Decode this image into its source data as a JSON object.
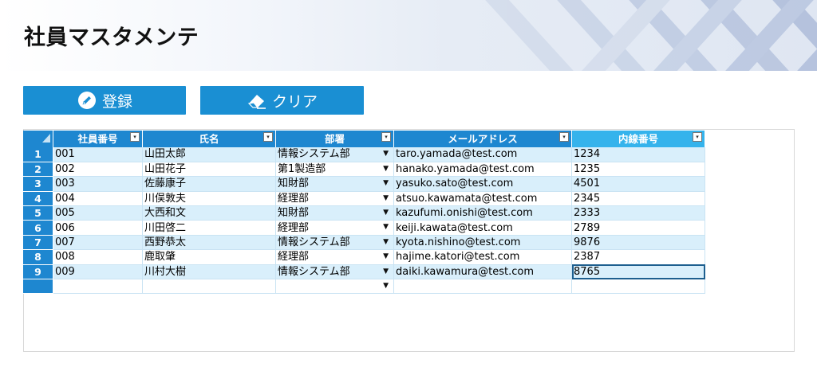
{
  "app": {
    "title": "社員マスタメンテ"
  },
  "toolbar": {
    "register_label": "登録",
    "clear_label": "クリア"
  },
  "table": {
    "columns": [
      "社員番号",
      "氏名",
      "部署",
      "メールアドレス",
      "内線番号"
    ],
    "rows": [
      {
        "no": "1",
        "id": "001",
        "name": "山田太郎",
        "dept": "情報システム部",
        "email": "taro.yamada@test.com",
        "ext": "1234"
      },
      {
        "no": "2",
        "id": "002",
        "name": "山田花子",
        "dept": "第1製造部",
        "email": "hanako.yamada@test.com",
        "ext": "1235"
      },
      {
        "no": "3",
        "id": "003",
        "name": "佐藤康子",
        "dept": "知財部",
        "email": "yasuko.sato@test.com",
        "ext": "4501"
      },
      {
        "no": "4",
        "id": "004",
        "name": "川俣敦夫",
        "dept": "経理部",
        "email": "atsuo.kawamata@test.com",
        "ext": "2345"
      },
      {
        "no": "5",
        "id": "005",
        "name": "大西和文",
        "dept": "知財部",
        "email": "kazufumi.onishi@test.com",
        "ext": "2333"
      },
      {
        "no": "6",
        "id": "006",
        "name": "川田啓二",
        "dept": "経理部",
        "email": "keiji.kawata@test.com",
        "ext": "2789"
      },
      {
        "no": "7",
        "id": "007",
        "name": "西野恭太",
        "dept": "情報システム部",
        "email": "kyota.nishino@test.com",
        "ext": "9876"
      },
      {
        "no": "8",
        "id": "008",
        "name": "鹿取肇",
        "dept": "経理部",
        "email": "hajime.katori@test.com",
        "ext": "2387"
      },
      {
        "no": "9",
        "id": "009",
        "name": "川村大樹",
        "dept": "情報システム部",
        "email": "daiki.kawamura@test.com",
        "ext": "8765"
      }
    ],
    "dropdown_glyph": "▼",
    "filter_glyph": "▾"
  },
  "colors": {
    "accent": "#1a8fd3",
    "header_blue": "#1e87d0",
    "active_header": "#35b3ec",
    "band": "#d9effb"
  },
  "icons": {
    "register": "pencil-circle-icon",
    "clear": "eraser-icon"
  }
}
